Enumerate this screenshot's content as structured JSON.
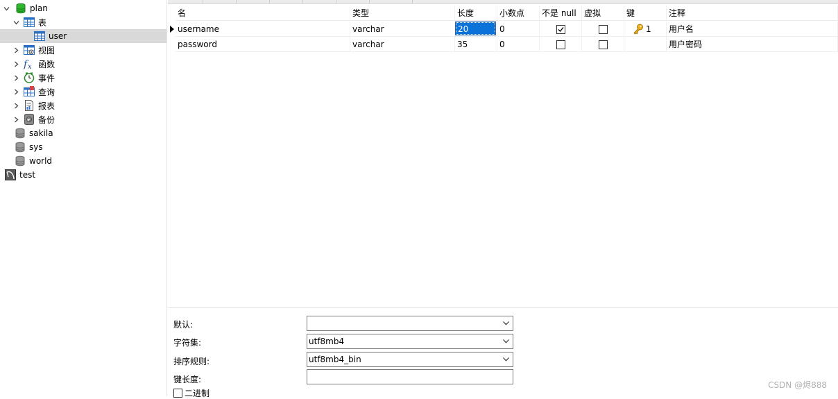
{
  "tree": {
    "items": [
      {
        "label": "plan"
      },
      {
        "label": "表"
      },
      {
        "label": "user"
      },
      {
        "label": "视图"
      },
      {
        "label": "函数"
      },
      {
        "label": "事件"
      },
      {
        "label": "查询"
      },
      {
        "label": "报表"
      },
      {
        "label": "备份"
      },
      {
        "label": "sakila"
      },
      {
        "label": "sys"
      },
      {
        "label": "world"
      },
      {
        "label": "test"
      }
    ]
  },
  "grid": {
    "headers": [
      "名",
      "类型",
      "长度",
      "小数点",
      "不是 null",
      "虚拟",
      "键",
      "注释"
    ],
    "rows": [
      {
        "name": "username",
        "type": "varchar",
        "length": "20",
        "decimals": "0",
        "not_null": true,
        "virtual": false,
        "key": "1",
        "comment": "用户名"
      },
      {
        "name": "password",
        "type": "varchar",
        "length": "35",
        "decimals": "0",
        "not_null": false,
        "virtual": false,
        "key": "",
        "comment": "用户密码"
      }
    ]
  },
  "props": {
    "default_label": "默认:",
    "default_value": "",
    "charset_label": "字符集:",
    "charset_value": "utf8mb4",
    "collation_label": "排序规则:",
    "collation_value": "utf8mb4_bin",
    "keylen_label": "键长度:",
    "keylen_value": "",
    "binary_label": "二进制"
  },
  "watermark": "CSDN @烬888",
  "colors": {
    "selection": "#0a72d8",
    "db_green": "#2aa52a",
    "key_gold": "#e0a21a"
  }
}
